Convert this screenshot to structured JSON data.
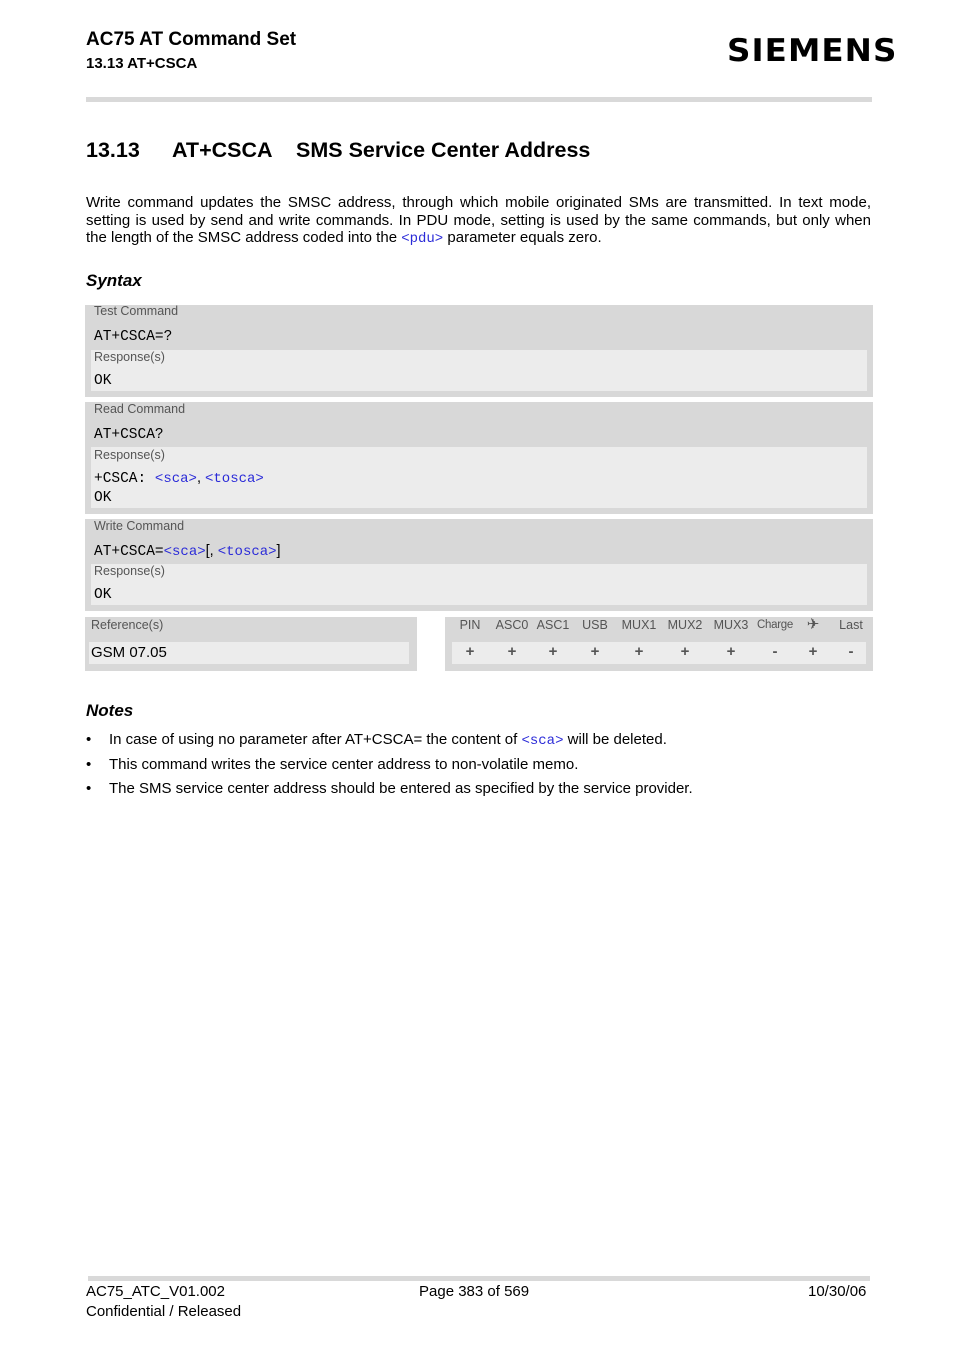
{
  "header": {
    "doc_title": "AC75 AT Command Set",
    "section_ref": "13.13 AT+CSCA",
    "logo": "SIEMENS"
  },
  "section": {
    "number": "13.13",
    "command": "AT+CSCA",
    "title": "SMS Service Center Address"
  },
  "intro": {
    "text_before": "Write command updates the SMSC address, through which mobile originated SMs are transmitted. In text mode, setting is used by send and write commands. In PDU mode, setting is used by the same commands, but only when the length of the SMSC address coded into the ",
    "param": "<pdu>",
    "text_after": " parameter equals zero."
  },
  "syntax": {
    "heading": "Syntax",
    "test": {
      "label": "Test Command",
      "command": "AT+CSCA=?",
      "response_label": "Response(s)",
      "response": "OK"
    },
    "read": {
      "label": "Read Command",
      "command": "AT+CSCA?",
      "response_label": "Response(s)",
      "response_prefix": "+CSCA: ",
      "response_param1": "<sca>",
      "response_sep": ", ",
      "response_param2": "<tosca>",
      "response_ok": "OK"
    },
    "write": {
      "label": "Write Command",
      "command_prefix": "AT+CSCA=",
      "param1": "<sca>",
      "bracket_open": "[, ",
      "param2": "<tosca>",
      "bracket_close": "]",
      "response_label": "Response(s)",
      "response": "OK"
    },
    "reference": {
      "label": "Reference(s)",
      "value": "GSM 07.05"
    },
    "availability": {
      "columns": [
        {
          "label": "PIN",
          "value": "+"
        },
        {
          "label": "ASC0",
          "value": "+"
        },
        {
          "label": "ASC1",
          "value": "+"
        },
        {
          "label": "USB",
          "value": "+"
        },
        {
          "label": "MUX1",
          "value": "+"
        },
        {
          "label": "MUX2",
          "value": "+"
        },
        {
          "label": "MUX3",
          "value": "+"
        },
        {
          "label": "Charge",
          "value": "-"
        },
        {
          "label": "✈",
          "value": "+"
        },
        {
          "label": "Last",
          "value": "-"
        }
      ]
    }
  },
  "notes": {
    "heading": "Notes",
    "items": [
      {
        "bullet": "•",
        "text_before": "In case of using no parameter after AT+CSCA= the content of ",
        "param": "<sca>",
        "text_after": " will be deleted."
      },
      {
        "bullet": "•",
        "text": "This command writes the service center address to non-volatile memo."
      },
      {
        "bullet": "•",
        "text": "The SMS service center address should be entered as specified by the service provider."
      }
    ]
  },
  "footer": {
    "doc_id": "AC75_ATC_V01.002",
    "page": "Page 383 of 569",
    "date": "10/30/06",
    "status": "Confidential / Released"
  }
}
